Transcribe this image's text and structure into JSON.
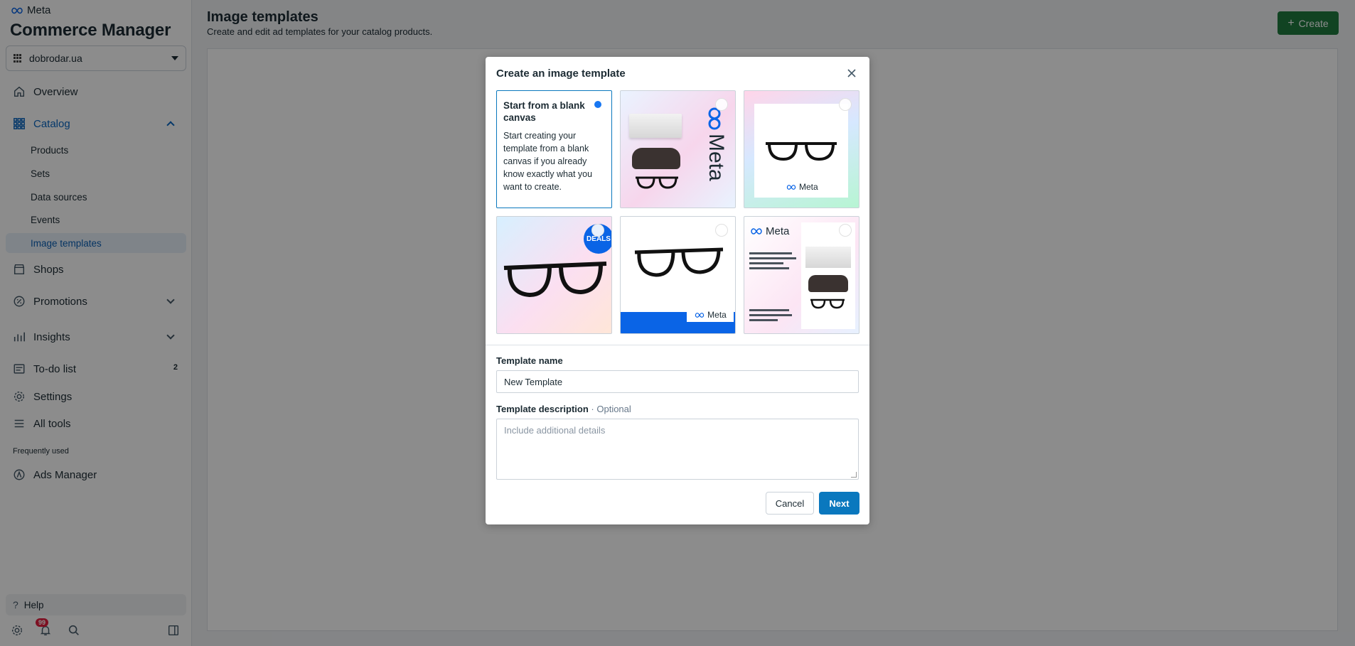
{
  "brand": {
    "name": "Meta",
    "app_title": "Commerce Manager"
  },
  "account": {
    "name": "dobrodar.ua"
  },
  "sidebar": {
    "items": [
      {
        "label": "Overview",
        "icon": "home-icon"
      },
      {
        "label": "Catalog",
        "icon": "catalog-grid-icon"
      },
      {
        "label": "Shops",
        "icon": "shop-icon"
      },
      {
        "label": "Promotions",
        "icon": "promotions-icon"
      },
      {
        "label": "Insights",
        "icon": "insights-icon"
      },
      {
        "label": "To-do list",
        "icon": "todo-icon",
        "count": "2"
      },
      {
        "label": "Settings",
        "icon": "gear-icon"
      },
      {
        "label": "All tools",
        "icon": "menu-icon"
      }
    ],
    "catalog_sub": [
      "Products",
      "Sets",
      "Data sources",
      "Events",
      "Image templates"
    ],
    "frequently_used_label": "Frequently used",
    "frequently_used": [
      {
        "label": "Ads Manager",
        "icon": "ads-manager-icon"
      }
    ],
    "help_label": "Help",
    "notification_count": "99"
  },
  "main": {
    "title": "Image templates",
    "subtitle": "Create and edit ad templates for your catalog products.",
    "create_label": "Create"
  },
  "modal": {
    "title": "Create an image template",
    "blank_tile": {
      "title": "Start from a blank canvas",
      "description": "Start creating your template from a blank canvas if you already know exactly what you want to create."
    },
    "tile_texts": {
      "meta_vertical": "Meta",
      "meta_word": "Meta",
      "deals": "DEALS"
    },
    "template_name_label": "Template name",
    "template_name_value": "New Template",
    "template_description_label": "Template description",
    "template_description_optional": "· Optional",
    "template_description_placeholder": "Include additional details",
    "cancel_label": "Cancel",
    "next_label": "Next"
  },
  "colors": {
    "accent": "#0a78be",
    "create_button": "#1f7a3f",
    "selected_radio": "#1877f2",
    "notification_badge": "#e41e3f"
  }
}
